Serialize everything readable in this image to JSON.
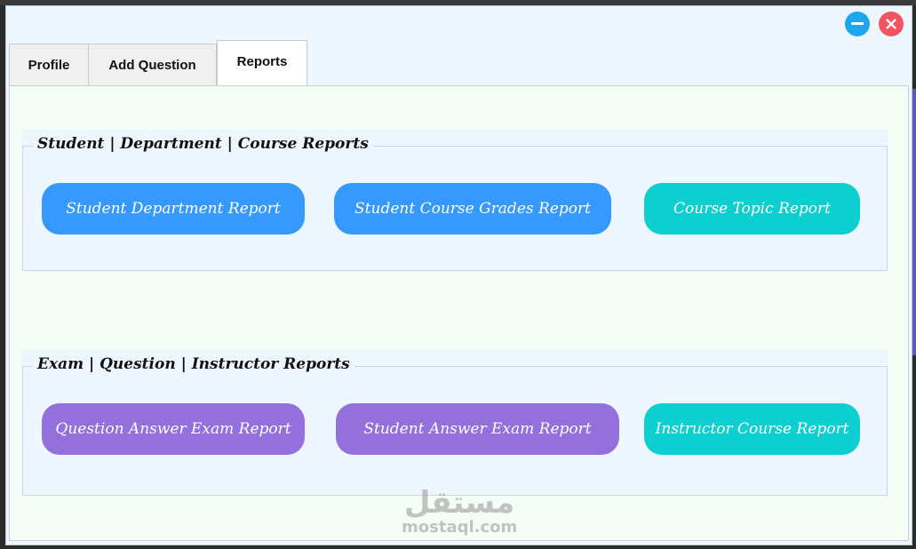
{
  "window": {
    "minimize_label": "minimize",
    "close_label": "close"
  },
  "tabs": [
    {
      "label": "Profile",
      "active": false
    },
    {
      "label": "Add Question",
      "active": false
    },
    {
      "label": "Reports",
      "active": true
    }
  ],
  "groups": [
    {
      "title": "Student | Department | Course Reports",
      "buttons": [
        {
          "label": "Student Department Report",
          "color": "#3599ff"
        },
        {
          "label": "Student Course Grades Report",
          "color": "#3599ff"
        },
        {
          "label": "Course Topic Report",
          "color": "#0dcfcf"
        }
      ]
    },
    {
      "title": "Exam | Question | Instructor Reports",
      "buttons": [
        {
          "label": "Question Answer Exam Report",
          "color": "#9370dc"
        },
        {
          "label": "Student Answer Exam Report",
          "color": "#9370dc"
        },
        {
          "label": "Instructor Course Report",
          "color": "#0dcfcf"
        }
      ]
    }
  ],
  "watermark": {
    "arabic": "مستقل",
    "latin": "mostaql.com"
  },
  "colors": {
    "window_bg": "#eef6ff",
    "panel_bg": "#f4fdf6",
    "minimize": "#1ba7f0",
    "close": "#f25561"
  }
}
